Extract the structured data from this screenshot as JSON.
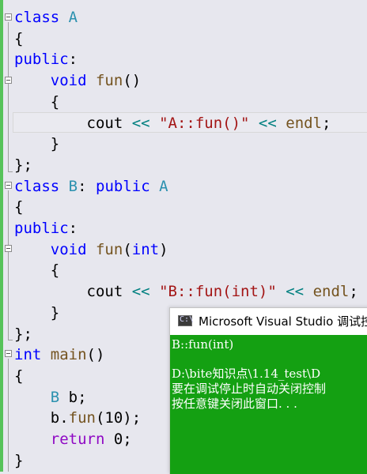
{
  "editor": {
    "lines": [
      [
        {
          "t": "class",
          "c": "kw"
        },
        {
          "t": " ",
          "c": "pl"
        },
        {
          "t": "A",
          "c": "ty"
        }
      ],
      [
        {
          "t": "{",
          "c": "pl"
        }
      ],
      [
        {
          "t": "public",
          "c": "kw"
        },
        {
          "t": ":",
          "c": "pl"
        }
      ],
      [
        {
          "t": "    ",
          "c": "pl"
        },
        {
          "t": "void",
          "c": "kw"
        },
        {
          "t": " ",
          "c": "pl"
        },
        {
          "t": "fun",
          "c": "fn"
        },
        {
          "t": "()",
          "c": "pl"
        }
      ],
      [
        {
          "t": "    {",
          "c": "pl"
        }
      ],
      [
        {
          "t": "        cout ",
          "c": "pl"
        },
        {
          "t": "<<",
          "c": "op"
        },
        {
          "t": " ",
          "c": "pl"
        },
        {
          "t": "\"A::fun()\"",
          "c": "str"
        },
        {
          "t": " ",
          "c": "pl"
        },
        {
          "t": "<<",
          "c": "op"
        },
        {
          "t": " ",
          "c": "pl"
        },
        {
          "t": "endl",
          "c": "fn"
        },
        {
          "t": ";",
          "c": "pl"
        }
      ],
      [
        {
          "t": "    }",
          "c": "pl"
        }
      ],
      [
        {
          "t": "};",
          "c": "pl"
        }
      ],
      [
        {
          "t": "class",
          "c": "kw"
        },
        {
          "t": " ",
          "c": "pl"
        },
        {
          "t": "B",
          "c": "ty"
        },
        {
          "t": ": ",
          "c": "pl"
        },
        {
          "t": "public",
          "c": "kw"
        },
        {
          "t": " ",
          "c": "pl"
        },
        {
          "t": "A",
          "c": "ty"
        }
      ],
      [
        {
          "t": "{",
          "c": "pl"
        }
      ],
      [
        {
          "t": "public",
          "c": "kw"
        },
        {
          "t": ":",
          "c": "pl"
        }
      ],
      [
        {
          "t": "    ",
          "c": "pl"
        },
        {
          "t": "void",
          "c": "kw"
        },
        {
          "t": " ",
          "c": "pl"
        },
        {
          "t": "fun",
          "c": "fn"
        },
        {
          "t": "(",
          "c": "pl"
        },
        {
          "t": "int",
          "c": "kw"
        },
        {
          "t": ")",
          "c": "pl"
        }
      ],
      [
        {
          "t": "    {",
          "c": "pl"
        }
      ],
      [
        {
          "t": "        cout ",
          "c": "pl"
        },
        {
          "t": "<<",
          "c": "op"
        },
        {
          "t": " ",
          "c": "pl"
        },
        {
          "t": "\"B::fun(int)\"",
          "c": "str"
        },
        {
          "t": " ",
          "c": "pl"
        },
        {
          "t": "<<",
          "c": "op"
        },
        {
          "t": " ",
          "c": "pl"
        },
        {
          "t": "endl",
          "c": "fn"
        },
        {
          "t": ";",
          "c": "pl"
        }
      ],
      [
        {
          "t": "    }",
          "c": "pl"
        }
      ],
      [
        {
          "t": "};",
          "c": "pl"
        }
      ],
      [
        {
          "t": "int",
          "c": "kw"
        },
        {
          "t": " ",
          "c": "pl"
        },
        {
          "t": "main",
          "c": "fn"
        },
        {
          "t": "()",
          "c": "pl"
        }
      ],
      [
        {
          "t": "{",
          "c": "pl"
        }
      ],
      [
        {
          "t": "    ",
          "c": "pl"
        },
        {
          "t": "B",
          "c": "ty"
        },
        {
          "t": " b;",
          "c": "pl"
        }
      ],
      [
        {
          "t": "    b.",
          "c": "pl"
        },
        {
          "t": "fun",
          "c": "fn"
        },
        {
          "t": "(10);",
          "c": "pl"
        }
      ],
      [
        {
          "t": "    ",
          "c": "pl"
        },
        {
          "t": "return",
          "c": "ctrl"
        },
        {
          "t": " 0;",
          "c": "pl"
        }
      ],
      [
        {
          "t": "}",
          "c": "pl"
        }
      ]
    ]
  },
  "console": {
    "title": "Microsoft Visual Studio 调试控",
    "icon": "console-app-icon",
    "icon_glyph": "C:\\",
    "lines": [
      "B::fun(int)",
      "",
      "D:\\bite知识点\\1.14_test\\D",
      "要在调试停止时自动关闭控制",
      "按任意键关闭此窗口. . ."
    ],
    "background_color": "#14a012",
    "text_color": "#ffffff"
  },
  "colors": {
    "keyword": "#0000ff",
    "type": "#2b91af",
    "function": "#74531f",
    "string": "#a31515",
    "operator": "#008080",
    "control": "#8f08c4",
    "change_bar": "#57c35a",
    "editor_background": "#e7e7ee"
  }
}
